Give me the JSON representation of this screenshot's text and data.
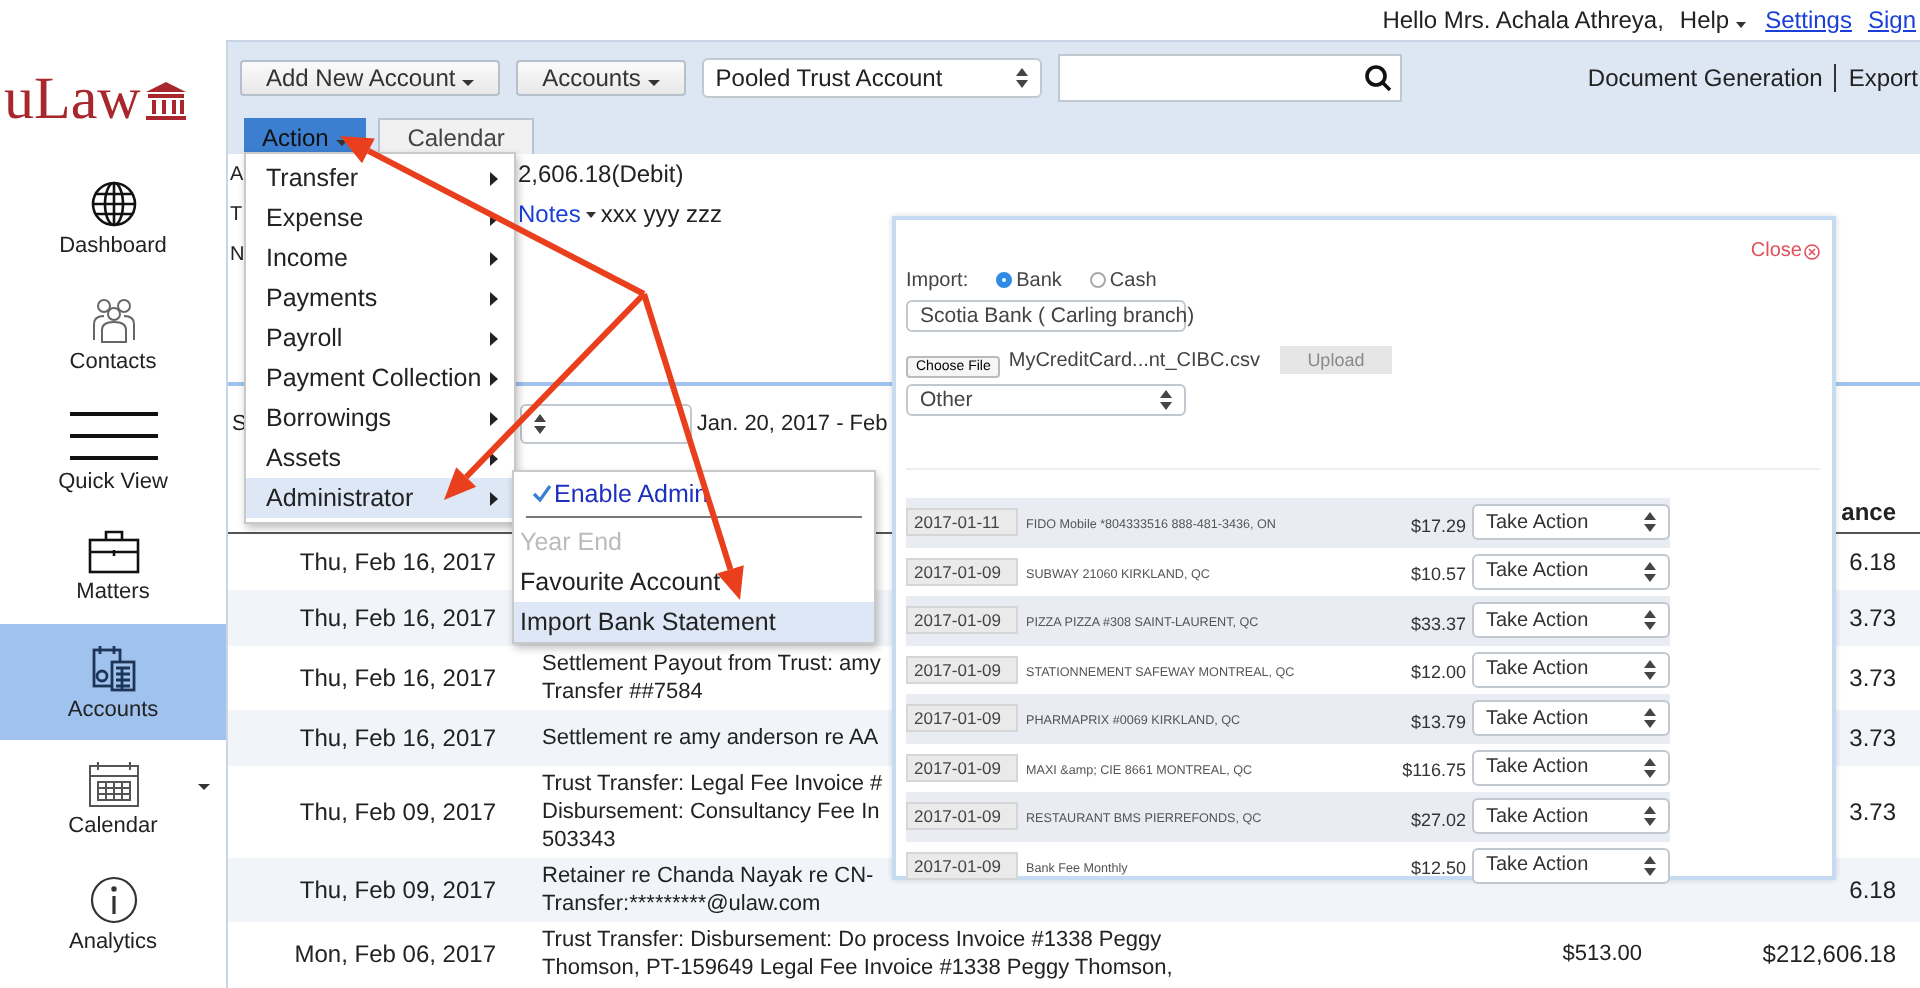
{
  "header": {
    "greeting": "Hello Mrs. Achala Athreya,",
    "links": [
      {
        "label": "Help",
        "kind": "dropdown"
      },
      {
        "label": "Settings",
        "kind": "link"
      },
      {
        "label": "Sign",
        "kind": "link"
      }
    ]
  },
  "logo": {
    "text": "uLaw"
  },
  "sidebar": {
    "items": [
      {
        "label": "Dashboard",
        "selected": false,
        "dropdown": false
      },
      {
        "label": "Contacts",
        "selected": false,
        "dropdown": false
      },
      {
        "label": "Quick View",
        "selected": false,
        "dropdown": false
      },
      {
        "label": "Matters",
        "selected": false,
        "dropdown": false
      },
      {
        "label": "Accounts",
        "selected": true,
        "dropdown": false
      },
      {
        "label": "Calendar",
        "selected": false,
        "dropdown": true
      },
      {
        "label": "Analytics",
        "selected": false,
        "dropdown": false
      }
    ]
  },
  "toolbar": {
    "buttons": [
      "Add New Account",
      "Accounts"
    ],
    "account_select": "Pooled Trust Account",
    "links": [
      "Document Generation",
      "Export"
    ]
  },
  "tabs": [
    {
      "label": "Action",
      "selected": true
    },
    {
      "label": "Calendar",
      "selected": false
    }
  ],
  "summary": {
    "labels": [
      "A",
      "T",
      "N"
    ],
    "balance": "2,606.18(Debit)",
    "notes_link": "Notes",
    "notes": "xxx yyy zzz",
    "filter_label": "S",
    "date_range": "Jan. 20, 2017 - Feb"
  },
  "table": {
    "balance_header": "ance",
    "rows": [
      {
        "date": "Thu, Feb 16, 2017",
        "description": [],
        "debit": "",
        "balance": "6.18"
      },
      {
        "date": "Thu, Feb 16, 2017",
        "description": [],
        "debit": "",
        "balance": "3.73"
      },
      {
        "date": "Thu, Feb 16, 2017",
        "description": [
          "Settlement Payout from Trust: amy",
          "Transfer ##7584"
        ],
        "debit": "",
        "balance": "3.73"
      },
      {
        "date": "Thu, Feb 16, 2017",
        "description": [
          "Settlement re amy anderson re AA"
        ],
        "debit": "",
        "balance": "3.73"
      },
      {
        "date": "Thu, Feb 09, 2017",
        "description": [
          "Trust Transfer: Legal Fee Invoice #",
          "Disbursement: Consultancy Fee In",
          "503343"
        ],
        "debit": "",
        "balance": "3.73"
      },
      {
        "date": "Thu, Feb 09, 2017",
        "description": [
          "Retainer re Chanda Nayak re CN-",
          "Transfer:*********@ulaw.com"
        ],
        "debit": "",
        "balance": "6.18"
      },
      {
        "date": "Mon, Feb 06, 2017",
        "description": [
          "Trust Transfer: Disbursement: Do process Invoice #1338 Peggy",
          "Thomson, PT-159649 Legal Fee Invoice #1338 Peggy Thomson,"
        ],
        "debit": "$513.00",
        "balance": "$212,606.18"
      }
    ]
  },
  "action_menu": {
    "items": [
      {
        "label": "Transfer",
        "selected": false
      },
      {
        "label": "Expense",
        "selected": false
      },
      {
        "label": "Income",
        "selected": false
      },
      {
        "label": "Payments",
        "selected": false
      },
      {
        "label": "Payroll",
        "selected": false
      },
      {
        "label": "Payment Collection",
        "selected": false
      },
      {
        "label": "Borrowings",
        "selected": false
      },
      {
        "label": "Assets",
        "selected": false
      },
      {
        "label": "Administrator",
        "selected": true
      }
    ]
  },
  "admin_submenu": {
    "items": [
      {
        "label": "Enable Admin",
        "checked": true,
        "disabled": false,
        "selected": false
      },
      {
        "label": "Year End",
        "checked": false,
        "disabled": true,
        "selected": false
      },
      {
        "label": "Favourite Account",
        "checked": false,
        "disabled": false,
        "selected": false
      },
      {
        "label": "Import Bank Statement",
        "checked": false,
        "disabled": false,
        "selected": true
      }
    ]
  },
  "import_dialog": {
    "close": "Close",
    "import_label": "Import:",
    "sources": [
      {
        "label": "Bank",
        "selected": true
      },
      {
        "label": "Cash",
        "selected": false
      }
    ],
    "bank_select": "Scotia Bank ( Carling branch)",
    "choose_file": "Choose File",
    "file_name": "MyCreditCard...nt_CIBC.csv",
    "upload": {
      "label": "Upload",
      "disabled": true
    },
    "format_select": "Other",
    "transactions": [
      {
        "date": "2017-01-11",
        "description": "FIDO Mobile *804333516 888-481-3436, ON",
        "amount": "$17.29",
        "action": "Take Action"
      },
      {
        "date": "2017-01-09",
        "description": "SUBWAY 21060 KIRKLAND, QC",
        "amount": "$10.57",
        "action": "Take Action"
      },
      {
        "date": "2017-01-09",
        "description": "PIZZA PIZZA #308 SAINT-LAURENT, QC",
        "amount": "$33.37",
        "action": "Take Action"
      },
      {
        "date": "2017-01-09",
        "description": "STATIONNEMENT SAFEWAY MONTREAL, QC",
        "amount": "$12.00",
        "action": "Take Action"
      },
      {
        "date": "2017-01-09",
        "description": "PHARMAPRIX #0069 KIRKLAND, QC",
        "amount": "$13.79",
        "action": "Take Action"
      },
      {
        "date": "2017-01-09",
        "description": "MAXI &amp; CIE 8661 MONTREAL, QC",
        "amount": "$116.75",
        "action": "Take Action"
      },
      {
        "date": "2017-01-09",
        "description": "RESTAURANT BMS PIERREFONDS, QC",
        "amount": "$27.02",
        "action": "Take Action"
      },
      {
        "date": "2017-01-09",
        "description": "Bank Fee Monthly",
        "amount": "$12.50",
        "action": "Take Action"
      }
    ]
  }
}
